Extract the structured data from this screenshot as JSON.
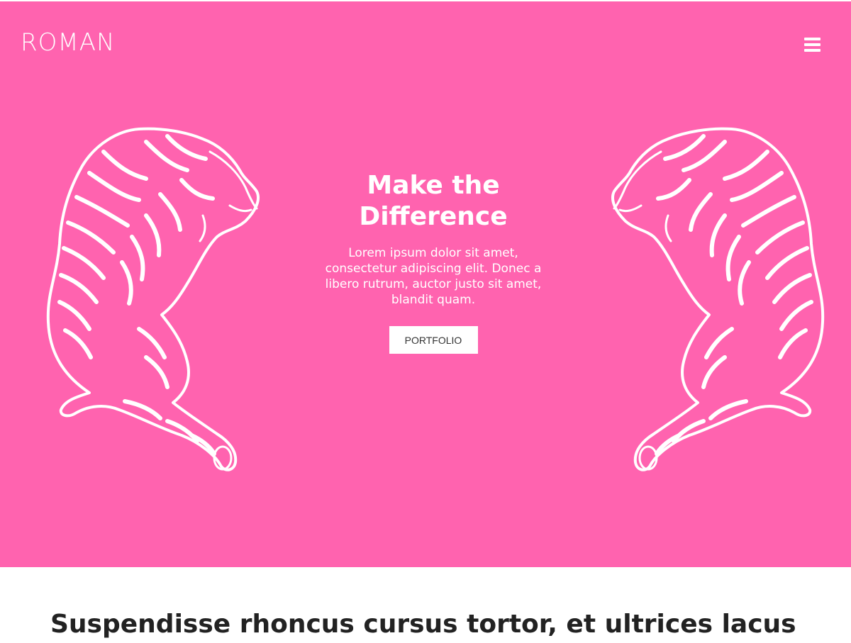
{
  "header": {
    "logo_text": "ROMAN",
    "menu_icon": "hamburger-menu-icon"
  },
  "colors": {
    "hero_background": "#ff63af",
    "text_on_hero": "#ffffff",
    "button_background": "#ffffff",
    "heading_dark": "#222222"
  },
  "hero": {
    "title_line1": "Make the",
    "title_line2": "Difference",
    "description": "Lorem ipsum dolor sit amet, consectetur adipiscing elit. Donec a libero rutrum, auctor justo sit amet, blandit quam.",
    "button_label": "PORTFOLIO",
    "left_illustration": "tiger-illustration",
    "right_illustration": "tiger-illustration"
  },
  "section": {
    "heading": "Suspendisse rhoncus cursus tortor, et ultrices lacus"
  }
}
